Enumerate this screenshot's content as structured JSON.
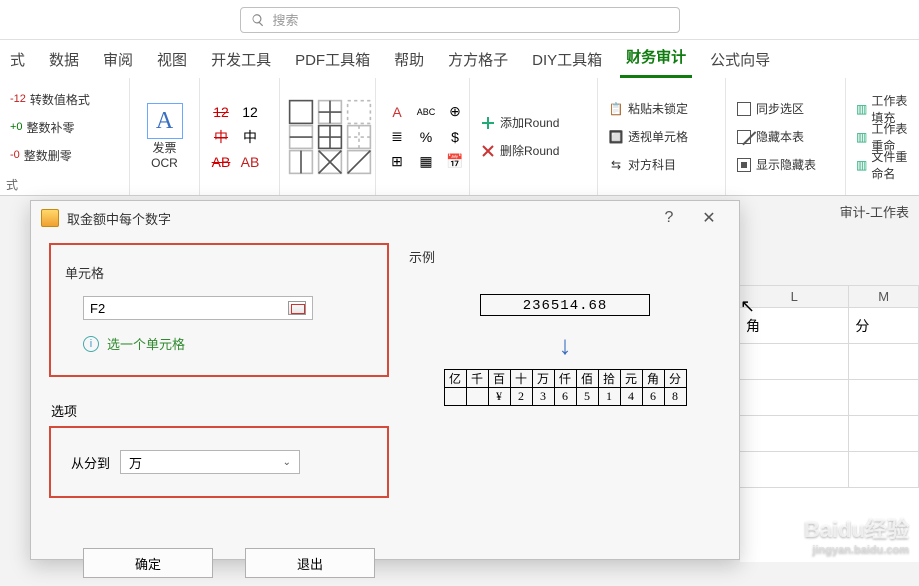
{
  "search": {
    "placeholder": "搜索"
  },
  "tabs": [
    "式",
    "数据",
    "审阅",
    "视图",
    "开发工具",
    "PDF工具箱",
    "帮助",
    "方方格子",
    "DIY工具箱",
    "财务审计",
    "公式向导"
  ],
  "active_tab": "财务审计",
  "ribbon": {
    "g1": {
      "cmd1": "转数值格式",
      "cmd1_badge": "-12",
      "cmd2": "整数补零",
      "cmd2_badge": "+0",
      "cmd3": "整数删零",
      "cmd3_badge": "-0",
      "label": "式"
    },
    "g2": {
      "label": "发票\nOCR"
    },
    "g3": {
      "col1": [
        "12",
        "中",
        "AB"
      ],
      "col2": [
        "12",
        "中",
        "AB"
      ]
    },
    "g6": {
      "c1": "A",
      "c2": "ABC",
      "c3": "%",
      "c4": "$",
      "c5": "⊞",
      "c6": "📅"
    },
    "g7": {
      "cmd1": "添加Round",
      "cmd2": "删除Round"
    },
    "g8": {
      "cmd1": "粘贴未锁定",
      "cmd2": "透视单元格",
      "cmd3": "对方科目"
    },
    "g9": {
      "cmd1": "同步选区",
      "cmd2": "隐藏本表",
      "cmd3": "显示隐藏表"
    },
    "g10": {
      "cmd1": "工作表填充",
      "cmd2": "工作表重命",
      "cmd3": "文件重命名"
    },
    "label_audit": "审计-工作表"
  },
  "sheet": {
    "colL": "L",
    "colM": "M",
    "h1": "角",
    "h2": "分"
  },
  "dialog": {
    "title": "取金额中每个数字",
    "help": "?",
    "cell_label": "单元格",
    "cell_value": "F2",
    "cell_hint": "选一个单元格",
    "options_label": "选项",
    "from_label": "从分到",
    "from_value": "万",
    "ok": "确定",
    "cancel": "退出",
    "example_label": "示例",
    "example_number": "236514.68",
    "digits_header": [
      "亿",
      "千",
      "百",
      "十",
      "万",
      "仟",
      "佰",
      "拾",
      "元",
      "角",
      "分"
    ],
    "digits_value": [
      "",
      "",
      "",
      "¥",
      "2",
      "3",
      "6",
      "5",
      "1",
      "4",
      "6",
      "8"
    ]
  },
  "watermark": {
    "brand": "Baidu经验",
    "url": "jingyan.baidu.com"
  }
}
